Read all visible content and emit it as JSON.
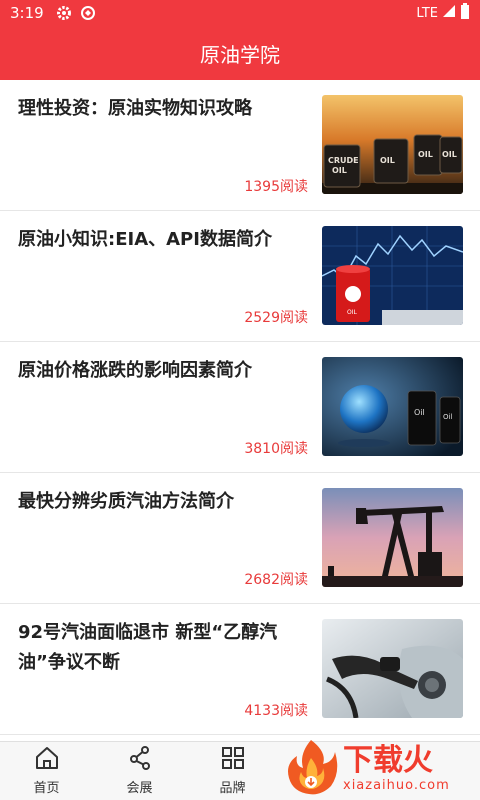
{
  "status_bar": {
    "time": "3:19",
    "network": "LTE"
  },
  "header": {
    "title": "原油学院"
  },
  "articles": [
    {
      "title": "理性投资：原油实物知识攻略",
      "reads": "1395阅读",
      "image": "crude-oil-barrels"
    },
    {
      "title": "原油小知识:EIA、API数据简介",
      "reads": "2529阅读",
      "image": "oil-barrel-chart"
    },
    {
      "title": "原油价格涨跌的影响因素简介",
      "reads": "3810阅读",
      "image": "globe-oil-barrels"
    },
    {
      "title": "最快分辨劣质汽油方法简介",
      "reads": "2682阅读",
      "image": "oil-pumpjack-sunset"
    },
    {
      "title": "92号汽油面临退市 新型“乙醇汽油”争议不断",
      "reads": "4133阅读",
      "image": "fuel-nozzle"
    }
  ],
  "tabs": [
    {
      "label": "首页",
      "icon": "home-icon"
    },
    {
      "label": "会展",
      "icon": "share-nodes-icon"
    },
    {
      "label": "品牌",
      "icon": "grid-icon"
    }
  ],
  "watermark": {
    "text": "下载火",
    "domain": "xiazaihuo.com"
  },
  "colors": {
    "primary": "#f0393f",
    "reads": "#e83b3b"
  }
}
